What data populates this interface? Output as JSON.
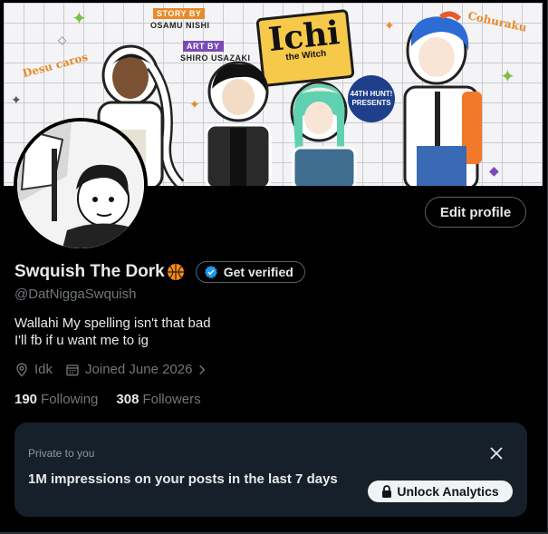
{
  "banner": {
    "credits": {
      "story_label": "STORY BY",
      "story_name": "OSAMU NISHI",
      "art_label": "ART BY",
      "art_name": "SHIRO USAZAKI"
    },
    "logo_main": "Ichi",
    "logo_sub": "the Witch",
    "side_left": "Desu caros",
    "side_right": "Cohuraku",
    "badge_line1": "44TH HUNT!",
    "badge_line2": "PRESENTS"
  },
  "profile": {
    "display_name": "Swquish The Dork",
    "handle": "@DatNiggaSwquish",
    "get_verified_label": "Get verified",
    "edit_profile_label": "Edit profile",
    "bio_lines": [
      "Wallahi My spelling isn't that bad",
      "I'll fb if u want me to ig"
    ],
    "location": "Idk",
    "joined": "Joined June 2026",
    "following_count": "190",
    "following_label": "Following",
    "followers_count": "308",
    "followers_label": "Followers"
  },
  "analytics_card": {
    "label": "Private to you",
    "text": "1M impressions on your posts in the last 7 days",
    "button_label": "Unlock Analytics"
  },
  "colors": {
    "background": "#000000",
    "text_primary": "#e7e9ea",
    "text_secondary": "#71767b",
    "card_bg": "#16202a",
    "verified_blue": "#1d9bf0",
    "basketball": "#f28b1c"
  },
  "icons": {
    "verified": "verified-badge-icon",
    "location": "location-pin-icon",
    "calendar": "calendar-icon",
    "chevron": "chevron-right-icon",
    "close": "close-icon",
    "lock": "lock-icon",
    "basketball": "basketball-emoji-icon"
  }
}
